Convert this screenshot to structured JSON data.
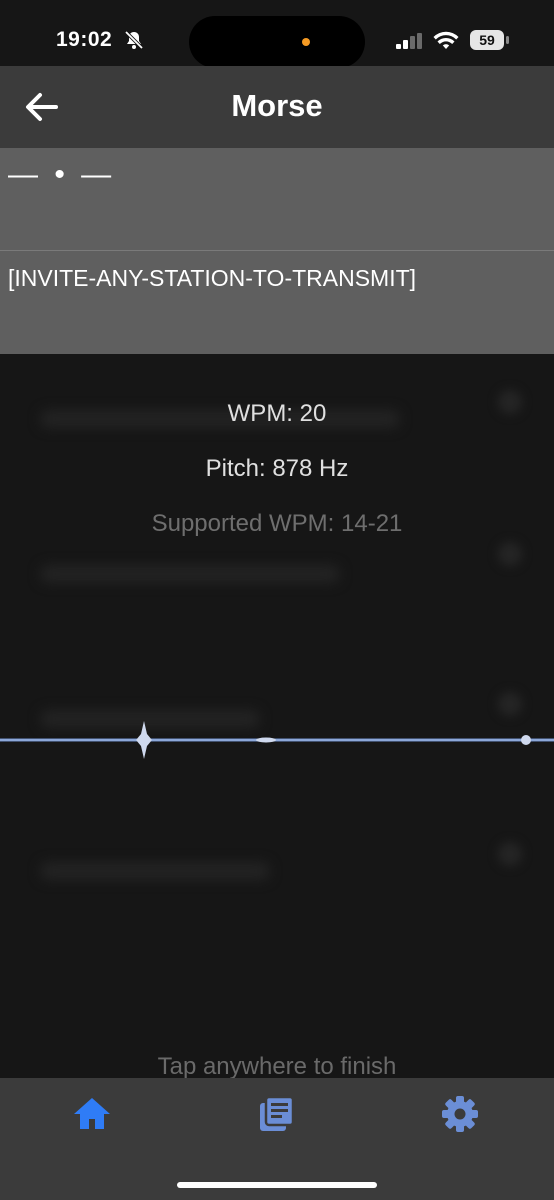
{
  "status_bar": {
    "time": "19:02",
    "battery_level": "59",
    "icons": [
      "bell-slash-icon",
      "signal-icon",
      "wifi-icon",
      "battery-icon"
    ]
  },
  "header": {
    "title": "Morse",
    "back_icon": "arrow-left-icon"
  },
  "morse_output": {
    "code": "— • —",
    "decoded": "[INVITE-ANY-STATION-TO-TRANSMIT]"
  },
  "info": {
    "wpm": "WPM: 20",
    "pitch": "Pitch: 878 Hz",
    "supported_wpm": "Supported WPM: 14-21"
  },
  "hint": {
    "finish": "Tap anywhere to finish"
  },
  "tab_bar": {
    "tabs": [
      {
        "icon": "home-icon",
        "active": true
      },
      {
        "icon": "log-icon",
        "active": false
      },
      {
        "icon": "gear-icon",
        "active": false
      }
    ]
  },
  "colors": {
    "accent": "#2f7cf6",
    "tab_inactive": "#6b8ed6",
    "panel": "#5f5f5f",
    "header": "#3b3b3b",
    "waveform": "#7ea0d8"
  }
}
